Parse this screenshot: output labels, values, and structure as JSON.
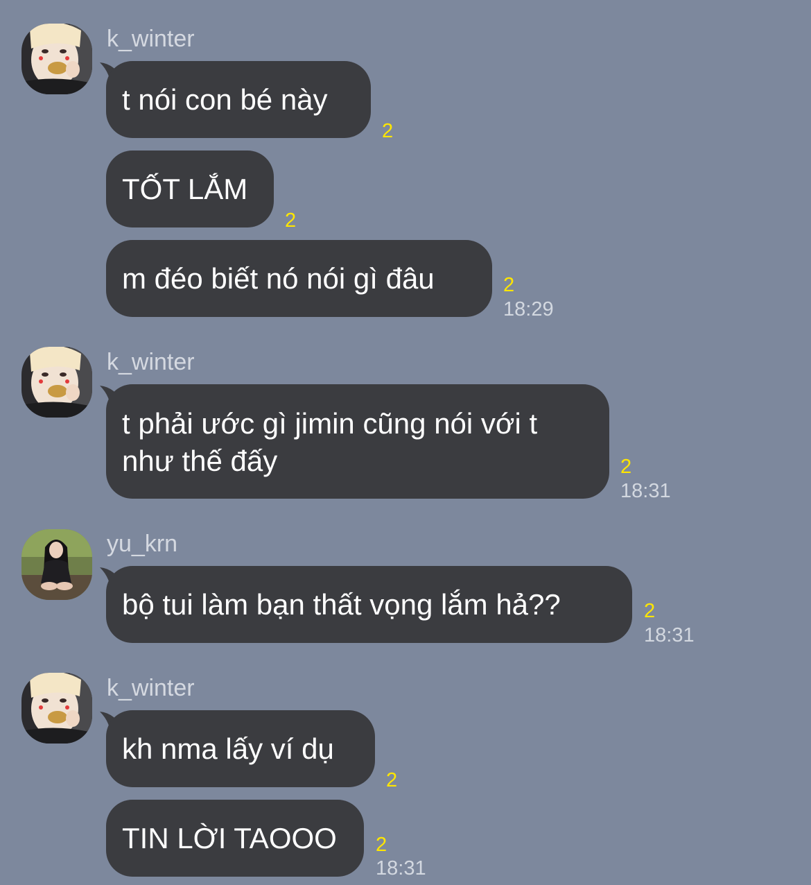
{
  "colors": {
    "background": "#7d889d",
    "bubble": "#3b3c40",
    "unread": "#ffe600",
    "username": "#d5d9e1",
    "timestamp": "#d3d8e0"
  },
  "messages": [
    {
      "sender": "k_winter",
      "avatar": "k-winter-avatar",
      "text": "t nói con bé này",
      "unread": "2",
      "time": ""
    },
    {
      "sender": "k_winter",
      "avatar": "k-winter-avatar",
      "text": "TỐT LẮM",
      "unread": "2",
      "time": ""
    },
    {
      "sender": "k_winter",
      "avatar": "k-winter-avatar",
      "text": "m đéo biết nó nói gì đâu",
      "unread": "2",
      "time": "18:29"
    },
    {
      "sender": "k_winter",
      "avatar": "k-winter-avatar",
      "text": "t phải ước gì jimin cũng nói với t như thế đấy",
      "unread": "2",
      "time": "18:31"
    },
    {
      "sender": "yu_krn",
      "avatar": "yu-krn-avatar",
      "text": "bộ tui làm bạn thất vọng lắm hả??",
      "unread": "2",
      "time": "18:31"
    },
    {
      "sender": "k_winter",
      "avatar": "k-winter-avatar",
      "text": "kh nma lấy ví dụ",
      "unread": "2",
      "time": ""
    },
    {
      "sender": "k_winter",
      "avatar": "k-winter-avatar",
      "text": "TIN LỜI TAOOO",
      "unread": "2",
      "time": "18:31"
    }
  ]
}
